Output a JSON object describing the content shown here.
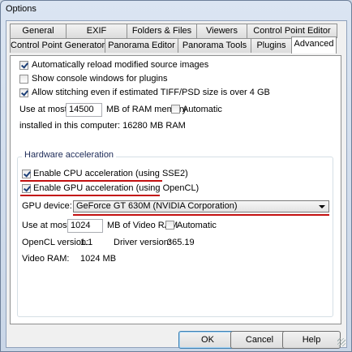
{
  "window": {
    "title": "Options"
  },
  "tabs_row1": [
    "General",
    "EXIF",
    "Folders & Files",
    "Viewers",
    "Control Point Editor"
  ],
  "tabs_row2": [
    "Control Point Generator",
    "Panorama Editor",
    "Panorama Tools",
    "Plugins",
    "Advanced"
  ],
  "active_tab": "Advanced",
  "advanced": {
    "auto_reload_label": "Automatically reload modified source images",
    "auto_reload_checked": true,
    "console_windows_label": "Show console windows for plugins",
    "console_windows_checked": false,
    "allow_stitching_label": "Allow stitching even if estimated TIFF/PSD size is over 4 GB",
    "allow_stitching_checked": true,
    "ram_use_label": "Use at most",
    "ram_value": "14500",
    "ram_unit_label": "MB of RAM memory",
    "ram_auto_label": "Automatic",
    "ram_auto_checked": false,
    "installed_ram_text": "installed in this computer: 16280 MB RAM"
  },
  "hardware": {
    "group_label": "Hardware acceleration",
    "cpu_accel_label": "Enable CPU acceleration (using SSE2)",
    "cpu_accel_checked": true,
    "gpu_accel_label": "Enable GPU acceleration (using OpenCL)",
    "gpu_accel_checked": true,
    "gpu_device_label": "GPU device:",
    "gpu_device_value": "GeForce GT 630M (NVIDIA Corporation)",
    "vram_use_label": "Use at most",
    "vram_value": "1024",
    "vram_unit_label": "MB of Video RAM",
    "vram_auto_label": "Automatic",
    "vram_auto_checked": false,
    "opencl_version_label": "OpenCL version:",
    "opencl_version_value": "1.1",
    "driver_version_label": "Driver version:",
    "driver_version_value": "365.19",
    "video_ram_label": "Video RAM:",
    "video_ram_value": "1024 MB"
  },
  "buttons": {
    "ok": "OK",
    "cancel": "Cancel",
    "help": "Help"
  },
  "colors": {
    "highlight_underline": "#c21010",
    "group_label": "#1c2a57"
  }
}
